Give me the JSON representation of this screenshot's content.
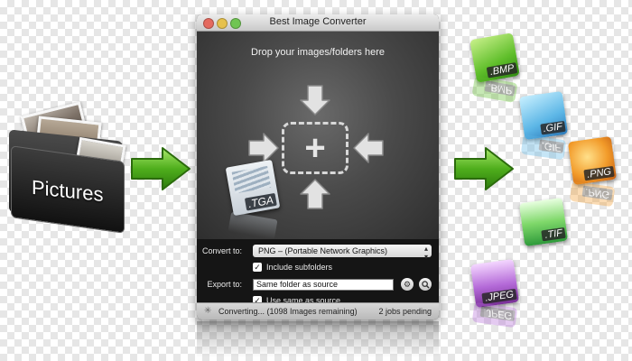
{
  "window": {
    "title": "Best Image Converter",
    "drop_text": "Drop your images/folders here",
    "dragged_file_ext": ".TGA"
  },
  "settings": {
    "convert_to_label": "Convert to:",
    "convert_to_value": "PNG – (Portable Network Graphics)",
    "include_subfolders_label": "Include subfolders",
    "include_subfolders_checked": true,
    "export_to_label": "Export to:",
    "export_to_value": "Same folder as source",
    "use_same_as_source_label": "Use same as source",
    "use_same_as_source_checked": true
  },
  "statusbar": {
    "status_text": "Converting... (1098 Images remaining)",
    "jobs_text": "2 jobs pending"
  },
  "source": {
    "folder_label": "Pictures"
  },
  "formats": [
    ".BMP",
    ".GIF",
    ".PNG",
    ".TIF",
    ".JPEG"
  ],
  "colors": {
    "arrow_green": "#4fae1c",
    "window_dark": "#2b2b2b"
  },
  "icons": [
    "add-icon",
    "gear-icon",
    "search-icon",
    "arrow-right-icon",
    "folder-icon"
  ]
}
